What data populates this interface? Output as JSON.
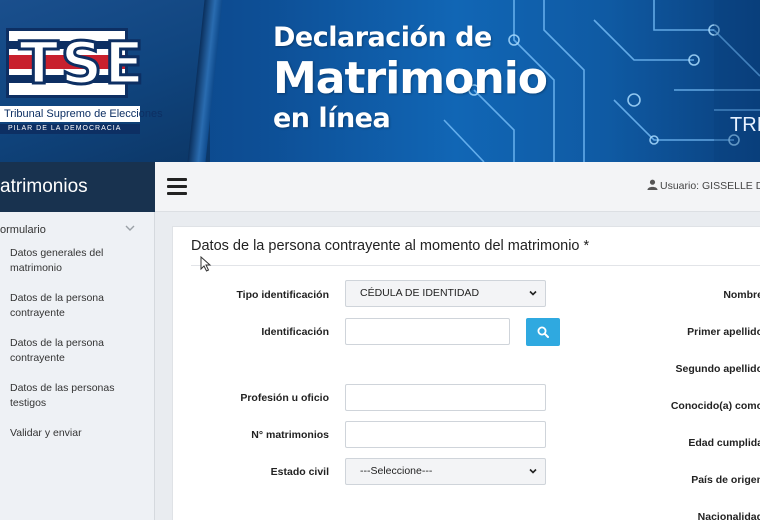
{
  "banner": {
    "logo_letters": "TSE",
    "logo_name": "Tribunal Supremo de Elecciones",
    "logo_motto": "PILAR DE LA DEMOCRACIA",
    "title_line1": "Declaración de",
    "title_line2": "Matrimonio",
    "title_line3": "en línea",
    "right_text": "TRI"
  },
  "sidebar": {
    "header": "atrimonios",
    "group_label": "ormulario",
    "items": [
      {
        "label": "Datos generales del matrimonio"
      },
      {
        "label": "Datos de la persona contrayente"
      },
      {
        "label": "Datos de la persona contrayente"
      },
      {
        "label": "Datos de las personas testigos"
      },
      {
        "label": "Validar y enviar"
      }
    ]
  },
  "topbar": {
    "user_text": "Usuario: GISSELLE D"
  },
  "form": {
    "title": "Datos de la persona contrayente al momento del matrimonio *",
    "left_fields": {
      "tipo_label": "Tipo identificación",
      "tipo_value": "CÉDULA DE IDENTIDAD",
      "identificacion_label": "Identificación",
      "identificacion_value": "",
      "profesion_label": "Profesión u oficio",
      "profesion_value": "",
      "matrimonios_label": "N° matrimonios",
      "matrimonios_value": "",
      "estado_label": "Estado civil",
      "estado_value": "---Seleccione---"
    },
    "right_labels": [
      "Nombre",
      "Primer apellido",
      "Segundo apellido",
      "Conocido(a) como",
      "Edad cumplida",
      "País de origen",
      "Nacionalidad"
    ]
  },
  "colors": {
    "sidebar_header": "#18324f",
    "search_button": "#2fa9e0",
    "banner_blue": "#0d4f96"
  }
}
